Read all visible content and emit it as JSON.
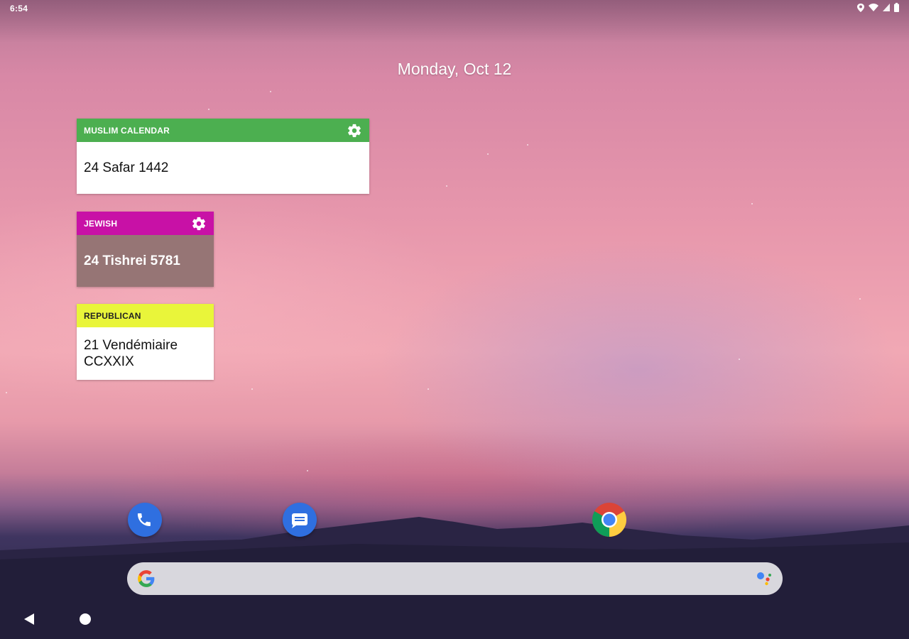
{
  "status_bar": {
    "time": "6:54"
  },
  "home": {
    "date": "Monday, Oct 12"
  },
  "widgets": {
    "muslim": {
      "title": "MUSLIM CALENDAR",
      "date": "24 Safar 1442",
      "header_color": "#4caf50"
    },
    "jewish": {
      "title": "JEWISH",
      "date": "24 Tishrei 5781",
      "header_color": "#c811a6",
      "body_color": "#967575"
    },
    "republican": {
      "title": "REPUBLICAN",
      "date_line1": "21 Vendémiaire",
      "date_line2": "CCXXIX",
      "header_color": "#e9f53a"
    }
  },
  "dock": {
    "apps": [
      {
        "name": "phone",
        "icon": "phone-icon"
      },
      {
        "name": "messages",
        "icon": "messages-icon"
      },
      {
        "name": "chrome",
        "icon": "chrome-icon"
      }
    ]
  },
  "search": {
    "logo": "google-g-icon",
    "assistant_icon": "google-assistant-icon"
  },
  "nav": {
    "back_icon": "back-triangle-icon",
    "home_icon": "home-circle-icon"
  }
}
